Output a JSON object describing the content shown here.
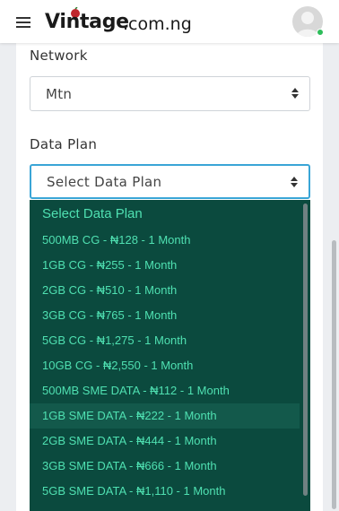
{
  "header": {
    "logo_main": "Vintage",
    "logo_domain": ".com.ng"
  },
  "form": {
    "network_label": "Network",
    "network_value": "Mtn",
    "data_plan_label": "Data Plan",
    "data_plan_value": "Select Data Plan"
  },
  "dropdown": {
    "options": [
      "Select Data Plan",
      "500MB CG - ₦128 - 1 Month",
      "1GB CG - ₦255 - 1 Month",
      "2GB CG - ₦510 - 1 Month",
      "3GB CG - ₦765 - 1 Month",
      "5GB CG - ₦1,275 - 1 Month",
      "10GB CG - ₦2,550 - 1 Month",
      "500MB SME DATA - ₦112 - 1 Month",
      "1GB SME DATA - ₦222 - 1 Month",
      "2GB SME DATA - ₦444 - 1 Month",
      "3GB SME DATA - ₦666 - 1 Month",
      "5GB SME DATA - ₦1,110 - 1 Month"
    ],
    "highlighted_index": 8
  },
  "colors": {
    "dropdown_bg": "#0b4a3e",
    "option_text": "#4fe0b1",
    "focus_border": "#3aa5d6",
    "online_dot": "#2dbd5a"
  }
}
